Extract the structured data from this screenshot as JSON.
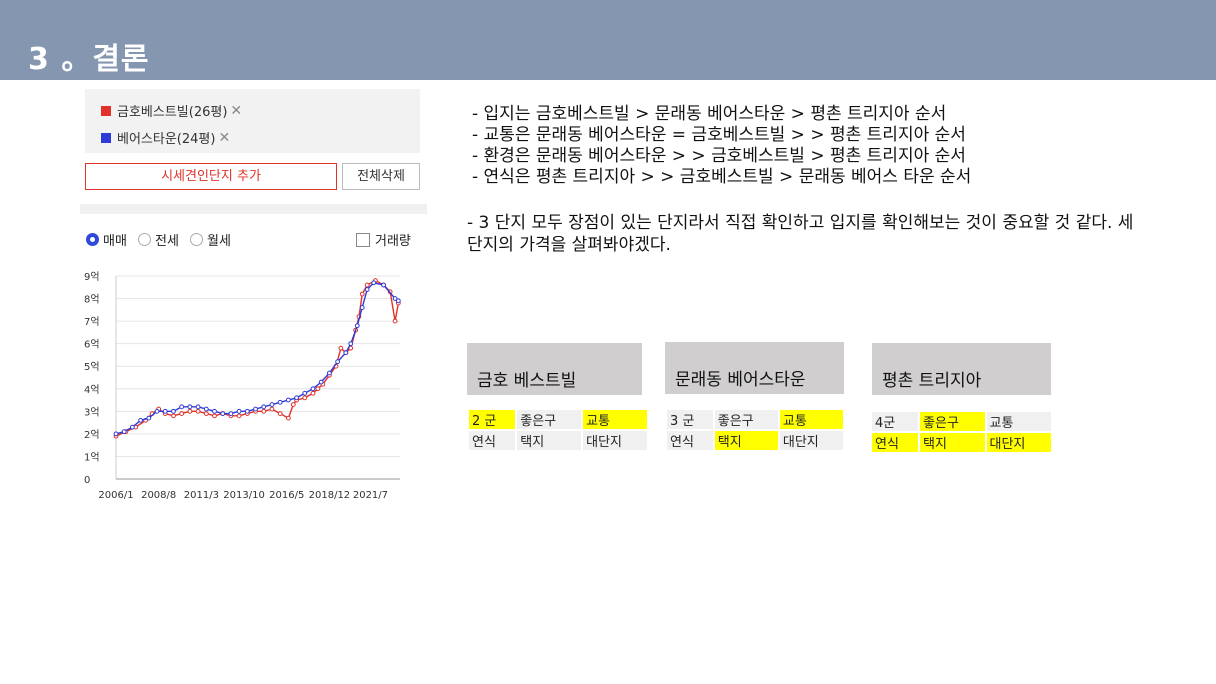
{
  "header": {
    "title": "3 。결론"
  },
  "legend": [
    {
      "label": "금호베스트빌(26평)",
      "color": "#e0322a"
    },
    {
      "label": "베어스타운(24평)",
      "color": "#2f3bd8"
    }
  ],
  "buttons": {
    "add": "시세견인단지 추가",
    "delete_all": "전체삭제"
  },
  "filters": {
    "radios": [
      "매매",
      "전세",
      "월세"
    ],
    "selected": "매매",
    "checkbox": "거래량"
  },
  "chart_data": {
    "type": "line",
    "y_ticks": [
      "0",
      "1억",
      "2억",
      "3억",
      "4억",
      "5억",
      "6억",
      "7억",
      "8억",
      "9억"
    ],
    "x_ticks": [
      "2006/1",
      "2008/8",
      "2011/3",
      "2013/10",
      "2016/5",
      "2018/12",
      "2021/7"
    ],
    "ylim": [
      0,
      9
    ],
    "xlim": [
      2006.0,
      2023.3
    ],
    "grid": true,
    "series": [
      {
        "name": "금호베스트빌(26평)",
        "color": "#e0322a",
        "x": [
          2006.0,
          2006.6,
          2007.2,
          2007.8,
          2008.2,
          2008.6,
          2009.0,
          2009.5,
          2010.0,
          2010.5,
          2011.0,
          2011.5,
          2012.0,
          2012.5,
          2013.0,
          2013.5,
          2014.0,
          2014.5,
          2015.0,
          2015.5,
          2016.0,
          2016.5,
          2016.8,
          2017.0,
          2017.5,
          2018.0,
          2018.3,
          2018.6,
          2019.0,
          2019.4,
          2019.7,
          2020.0,
          2020.3,
          2020.6,
          2020.8,
          2021.0,
          2021.3,
          2021.8,
          2022.3,
          2022.7,
          2023.0,
          2023.2
        ],
        "y": [
          1.9,
          2.1,
          2.3,
          2.6,
          2.9,
          3.1,
          2.9,
          2.8,
          2.9,
          3.0,
          3.0,
          2.9,
          2.8,
          2.9,
          2.8,
          2.8,
          2.9,
          3.0,
          3.0,
          3.1,
          2.9,
          2.7,
          3.3,
          3.5,
          3.6,
          3.8,
          4.0,
          4.2,
          4.6,
          5.0,
          5.8,
          5.6,
          5.8,
          6.6,
          7.2,
          8.2,
          8.6,
          8.8,
          8.6,
          8.3,
          7.0,
          7.8
        ]
      },
      {
        "name": "베어스타운(24평)",
        "color": "#2f3bd8",
        "x": [
          2006.0,
          2006.5,
          2007.0,
          2007.5,
          2008.0,
          2008.5,
          2009.0,
          2009.5,
          2010.0,
          2010.5,
          2011.0,
          2011.5,
          2012.0,
          2012.5,
          2013.0,
          2013.5,
          2014.0,
          2014.5,
          2015.0,
          2015.5,
          2016.0,
          2016.5,
          2017.0,
          2017.5,
          2018.0,
          2018.5,
          2019.0,
          2019.5,
          2020.0,
          2020.3,
          2020.7,
          2021.0,
          2021.3,
          2021.7,
          2022.3,
          2023.0,
          2023.2
        ],
        "y": [
          2.0,
          2.1,
          2.3,
          2.6,
          2.7,
          3.0,
          3.0,
          3.0,
          3.2,
          3.2,
          3.2,
          3.1,
          3.0,
          2.9,
          2.9,
          3.0,
          3.0,
          3.1,
          3.2,
          3.3,
          3.4,
          3.5,
          3.6,
          3.8,
          4.0,
          4.3,
          4.7,
          5.2,
          5.6,
          6.0,
          6.8,
          7.6,
          8.4,
          8.7,
          8.6,
          8.0,
          7.9
        ]
      }
    ]
  },
  "bullets": [
    "- 입지는 금호베스트빌 > 문래동 베어스타운 > 평촌 트리지아 순서",
    "- 교통은 문래동 베어스타운 = 금호베스트빌 > > 평촌 트리지아 순서",
    "- 환경은 문래동 베어스타운 > > 금호베스트빌 > 평촌 트리지아 순서",
    "- 연식은 평촌 트리지아 > > 금호베스트빌 > 문래동 베어스 타운 순서"
  ],
  "conclusion": "- 3 단지 모두 장점이 있는 단지라서 직접 확인하고 입지를 확인해보는 것이 중요할 것 같다.  세 단지의 가격을 살펴봐야겠다.",
  "cards": [
    {
      "title": "금호 베스트빌",
      "rows": [
        [
          {
            "t": "2 군",
            "h": true
          },
          {
            "t": "좋은구",
            "h": false
          },
          {
            "t": "교통",
            "h": true
          }
        ],
        [
          {
            "t": "연식",
            "h": false
          },
          {
            "t": "택지",
            "h": false
          },
          {
            "t": "대단지",
            "h": false
          }
        ]
      ]
    },
    {
      "title": "문래동 베어스타운",
      "rows": [
        [
          {
            "t": "3 군",
            "h": false
          },
          {
            "t": "좋은구",
            "h": false
          },
          {
            "t": "교통",
            "h": true
          }
        ],
        [
          {
            "t": "연식",
            "h": false
          },
          {
            "t": "택지",
            "h": true
          },
          {
            "t": "대단지",
            "h": false
          }
        ]
      ]
    },
    {
      "title": "평촌 트리지아",
      "rows": [
        [
          {
            "t": "4군",
            "h": false
          },
          {
            "t": "좋은구",
            "h": true
          },
          {
            "t": "교통",
            "h": false
          }
        ],
        [
          {
            "t": "연식",
            "h": true
          },
          {
            "t": "택지",
            "h": true
          },
          {
            "t": "대단지",
            "h": true
          }
        ]
      ]
    }
  ]
}
